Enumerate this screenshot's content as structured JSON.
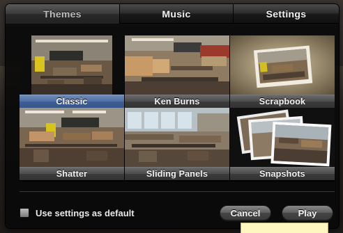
{
  "tabs": [
    {
      "label": "Themes",
      "active": true
    },
    {
      "label": "Music",
      "active": false
    },
    {
      "label": "Settings",
      "active": false
    }
  ],
  "themes": [
    {
      "label": "Classic",
      "selected": true
    },
    {
      "label": "Ken Burns",
      "selected": false
    },
    {
      "label": "Scrapbook",
      "selected": false
    },
    {
      "label": "Shatter",
      "selected": false
    },
    {
      "label": "Sliding Panels",
      "selected": false
    },
    {
      "label": "Snapshots",
      "selected": false
    }
  ],
  "options": {
    "default_label": "Use settings as default",
    "default_checked": false
  },
  "buttons": {
    "cancel": "Cancel",
    "play": "Play"
  },
  "colors": {
    "selection": "#4f6ea3",
    "tooltip": "#fff6c0"
  }
}
